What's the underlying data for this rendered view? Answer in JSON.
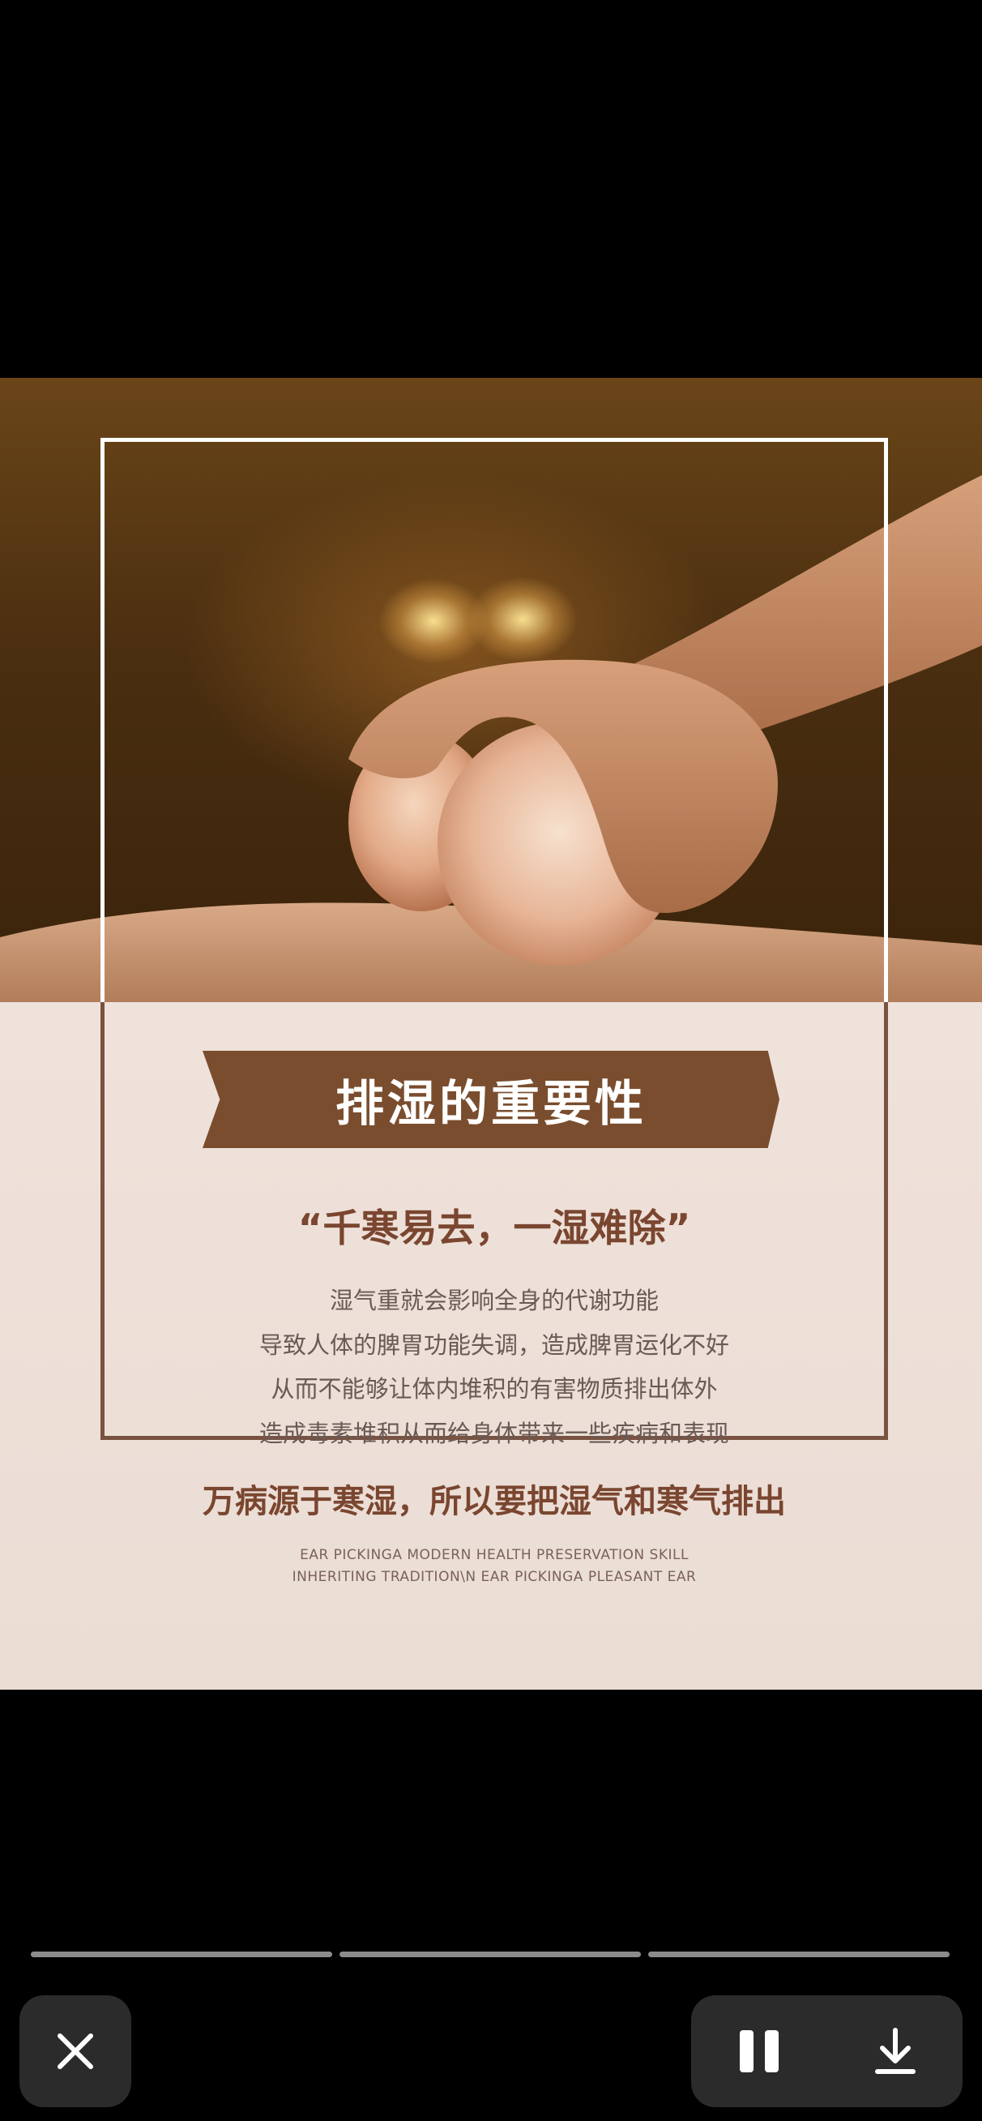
{
  "poster": {
    "banner_title": "排湿的重要性",
    "quote": "“千寒易去，一湿难除”",
    "body_lines": [
      "湿气重就会影响全身的代谢功能",
      "导致人体的脾胃功能失调，造成脾胃运化不好",
      "从而不能够让体内堆积的有害物质排出体外",
      "造成毒素堆积从而给身体带来一些疾病和表现"
    ],
    "headline": "万病源于寒湿，所以要把湿气和寒气排出",
    "english_lines": [
      "EAR PICKINGA MODERN HEALTH PRESERVATION SKILL",
      "INHERITING TRADITION\\N EAR PICKINGA PLEASANT EAR"
    ],
    "colors": {
      "banner": "#7a4d2e",
      "accent_text": "#7a4630",
      "body_text": "#6a5a55",
      "panel_background": "#efe2da"
    }
  },
  "viewer": {
    "progress": {
      "segments": 3
    },
    "controls": {
      "close_icon": "close-icon",
      "pause_icon": "pause-icon",
      "download_icon": "download-icon"
    }
  }
}
